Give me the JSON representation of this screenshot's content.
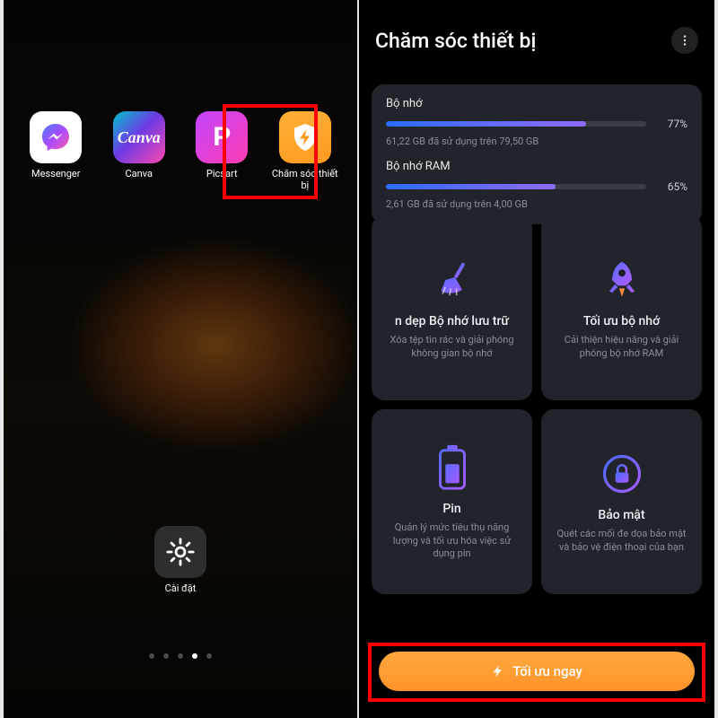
{
  "left": {
    "apps": [
      {
        "label": "Messenger"
      },
      {
        "label": "Canva"
      },
      {
        "label": "Picsart"
      },
      {
        "label": "Chăm sóc thiết bị"
      }
    ],
    "settings_label": "Cài đặt",
    "page_dots": {
      "count": 5,
      "active": 3
    }
  },
  "right": {
    "title": "Chăm sóc thiết bị",
    "storage": {
      "title": "Bộ nhớ",
      "detail": "61,22 GB đã sử dụng trên 79,50 GB",
      "percent_label": "77%",
      "percent": 77
    },
    "ram": {
      "title": "Bộ nhớ RAM",
      "detail": "2,61 GB đã sử dụng trên 4,00 GB",
      "percent_label": "65%",
      "percent": 65
    },
    "tiles": [
      {
        "title": "n dẹp Bộ nhớ lưu trữ",
        "desc": "Xóa tệp tin rác và giải phóng không gian bộ nhớ"
      },
      {
        "title": "Tối ưu bộ nhớ",
        "desc": "Cải thiện hiệu năng và giải phóng bộ nhớ RAM"
      },
      {
        "title": "Pin",
        "desc": "Quản lý mức tiêu thụ năng lượng và tối ưu hóa việc sử dụng pin"
      },
      {
        "title": "Bảo mật",
        "desc": "Quét các mối đe dọa bảo mật và bảo vệ điện thoại của bạn"
      }
    ],
    "optimize_label": "Tối ưu ngay"
  }
}
